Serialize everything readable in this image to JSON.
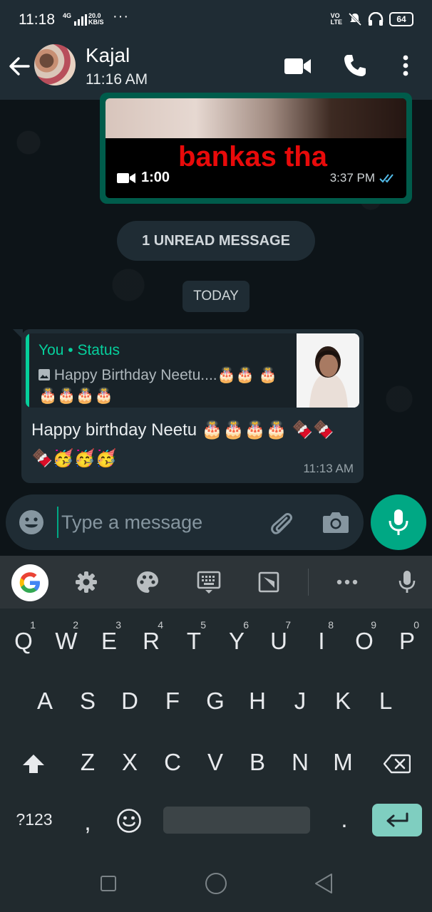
{
  "status_bar": {
    "time": "11:18",
    "network": "4G",
    "speed_top": "20.0",
    "speed_unit": "KB/S",
    "more": "···",
    "volte_top": "VO",
    "volte_bottom": "LTE",
    "battery": "64"
  },
  "header": {
    "contact_name": "Kajal",
    "last_seen": "11:16 AM",
    "icons": [
      "back-arrow-icon",
      "video-call-icon",
      "phone-icon",
      "more-vert-icon"
    ]
  },
  "chat": {
    "video_message": {
      "caption": "bankas tha",
      "duration": "1:00",
      "time": "3:37 PM",
      "status": "read"
    },
    "unread_banner": "1 UNREAD MESSAGE",
    "date_chip": "TODAY",
    "message": {
      "quote_title": "You • Status",
      "quote_text": "Happy Birthday Neetu....🎂🎂 🎂🎂🎂🎂🎂",
      "text": "Happy birthday Neetu 🎂🎂🎂🎂 🍫🍫🍫🥳🥳🥳",
      "time": "11:13 AM"
    }
  },
  "composer": {
    "placeholder": "Type a message"
  },
  "keyboard": {
    "toolbar": [
      "google-icon",
      "settings-icon",
      "theme-palette-icon",
      "keyboard-icon",
      "one-handed-icon",
      "more-icon",
      "voice-input-icon"
    ],
    "row1": [
      {
        "label": "Q",
        "hint": "1"
      },
      {
        "label": "W",
        "hint": "2"
      },
      {
        "label": "E",
        "hint": "3"
      },
      {
        "label": "R",
        "hint": "4"
      },
      {
        "label": "T",
        "hint": "5"
      },
      {
        "label": "Y",
        "hint": "6"
      },
      {
        "label": "U",
        "hint": "7"
      },
      {
        "label": "I",
        "hint": "8"
      },
      {
        "label": "O",
        "hint": "9"
      },
      {
        "label": "P",
        "hint": "0"
      }
    ],
    "row2": [
      "A",
      "S",
      "D",
      "F",
      "G",
      "H",
      "J",
      "K",
      "L"
    ],
    "row3": [
      "Z",
      "X",
      "C",
      "V",
      "B",
      "N",
      "M"
    ],
    "symbols_label": "?123",
    "comma": ",",
    "period": "."
  }
}
